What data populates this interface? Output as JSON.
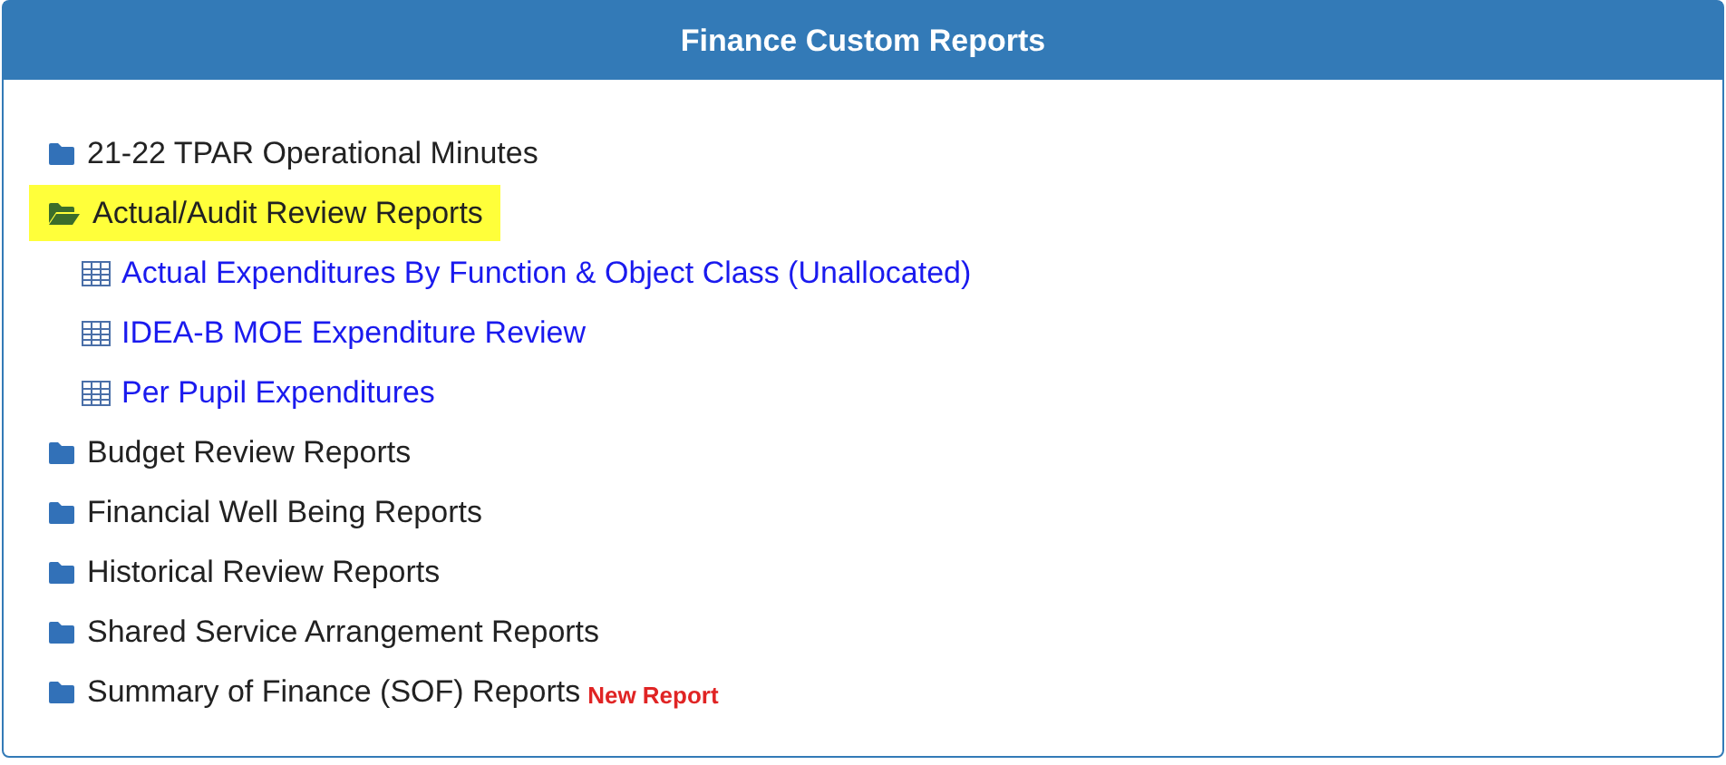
{
  "panel": {
    "title": "Finance Custom Reports"
  },
  "tree": [
    {
      "kind": "folder",
      "label": "21-22 TPAR Operational Minutes",
      "expanded": false,
      "selected": false
    },
    {
      "kind": "folder",
      "label": "Actual/Audit Review Reports",
      "expanded": true,
      "selected": true,
      "children": [
        {
          "kind": "report",
          "label": "Actual Expenditures By Function & Object Class (Unallocated)"
        },
        {
          "kind": "report",
          "label": "IDEA-B MOE Expenditure Review"
        },
        {
          "kind": "report",
          "label": "Per Pupil Expenditures"
        }
      ]
    },
    {
      "kind": "folder",
      "label": "Budget Review Reports",
      "expanded": false,
      "selected": false
    },
    {
      "kind": "folder",
      "label": "Financial Well Being Reports",
      "expanded": false,
      "selected": false
    },
    {
      "kind": "folder",
      "label": "Historical Review Reports",
      "expanded": false,
      "selected": false
    },
    {
      "kind": "folder",
      "label": "Shared Service Arrangement Reports",
      "expanded": false,
      "selected": false
    },
    {
      "kind": "folder",
      "label": "Summary of Finance (SOF) Reports",
      "expanded": false,
      "selected": false,
      "badge": "New Report"
    }
  ]
}
